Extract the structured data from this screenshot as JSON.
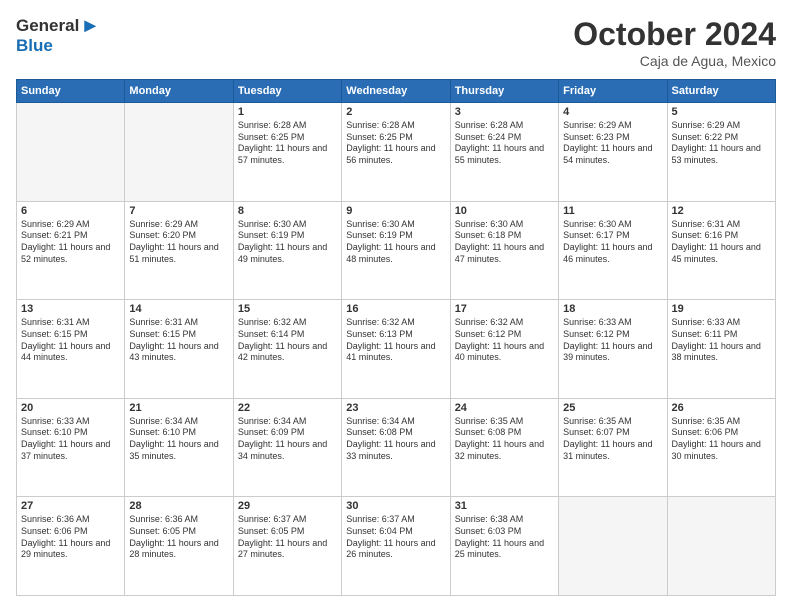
{
  "header": {
    "logo_general": "General",
    "logo_blue": "Blue",
    "month": "October 2024",
    "location": "Caja de Agua, Mexico"
  },
  "weekdays": [
    "Sunday",
    "Monday",
    "Tuesday",
    "Wednesday",
    "Thursday",
    "Friday",
    "Saturday"
  ],
  "weeks": [
    [
      {
        "day": "",
        "info": ""
      },
      {
        "day": "",
        "info": ""
      },
      {
        "day": "1",
        "info": "Sunrise: 6:28 AM\nSunset: 6:25 PM\nDaylight: 11 hours and 57 minutes."
      },
      {
        "day": "2",
        "info": "Sunrise: 6:28 AM\nSunset: 6:25 PM\nDaylight: 11 hours and 56 minutes."
      },
      {
        "day": "3",
        "info": "Sunrise: 6:28 AM\nSunset: 6:24 PM\nDaylight: 11 hours and 55 minutes."
      },
      {
        "day": "4",
        "info": "Sunrise: 6:29 AM\nSunset: 6:23 PM\nDaylight: 11 hours and 54 minutes."
      },
      {
        "day": "5",
        "info": "Sunrise: 6:29 AM\nSunset: 6:22 PM\nDaylight: 11 hours and 53 minutes."
      }
    ],
    [
      {
        "day": "6",
        "info": "Sunrise: 6:29 AM\nSunset: 6:21 PM\nDaylight: 11 hours and 52 minutes."
      },
      {
        "day": "7",
        "info": "Sunrise: 6:29 AM\nSunset: 6:20 PM\nDaylight: 11 hours and 51 minutes."
      },
      {
        "day": "8",
        "info": "Sunrise: 6:30 AM\nSunset: 6:19 PM\nDaylight: 11 hours and 49 minutes."
      },
      {
        "day": "9",
        "info": "Sunrise: 6:30 AM\nSunset: 6:19 PM\nDaylight: 11 hours and 48 minutes."
      },
      {
        "day": "10",
        "info": "Sunrise: 6:30 AM\nSunset: 6:18 PM\nDaylight: 11 hours and 47 minutes."
      },
      {
        "day": "11",
        "info": "Sunrise: 6:30 AM\nSunset: 6:17 PM\nDaylight: 11 hours and 46 minutes."
      },
      {
        "day": "12",
        "info": "Sunrise: 6:31 AM\nSunset: 6:16 PM\nDaylight: 11 hours and 45 minutes."
      }
    ],
    [
      {
        "day": "13",
        "info": "Sunrise: 6:31 AM\nSunset: 6:15 PM\nDaylight: 11 hours and 44 minutes."
      },
      {
        "day": "14",
        "info": "Sunrise: 6:31 AM\nSunset: 6:15 PM\nDaylight: 11 hours and 43 minutes."
      },
      {
        "day": "15",
        "info": "Sunrise: 6:32 AM\nSunset: 6:14 PM\nDaylight: 11 hours and 42 minutes."
      },
      {
        "day": "16",
        "info": "Sunrise: 6:32 AM\nSunset: 6:13 PM\nDaylight: 11 hours and 41 minutes."
      },
      {
        "day": "17",
        "info": "Sunrise: 6:32 AM\nSunset: 6:12 PM\nDaylight: 11 hours and 40 minutes."
      },
      {
        "day": "18",
        "info": "Sunrise: 6:33 AM\nSunset: 6:12 PM\nDaylight: 11 hours and 39 minutes."
      },
      {
        "day": "19",
        "info": "Sunrise: 6:33 AM\nSunset: 6:11 PM\nDaylight: 11 hours and 38 minutes."
      }
    ],
    [
      {
        "day": "20",
        "info": "Sunrise: 6:33 AM\nSunset: 6:10 PM\nDaylight: 11 hours and 37 minutes."
      },
      {
        "day": "21",
        "info": "Sunrise: 6:34 AM\nSunset: 6:10 PM\nDaylight: 11 hours and 35 minutes."
      },
      {
        "day": "22",
        "info": "Sunrise: 6:34 AM\nSunset: 6:09 PM\nDaylight: 11 hours and 34 minutes."
      },
      {
        "day": "23",
        "info": "Sunrise: 6:34 AM\nSunset: 6:08 PM\nDaylight: 11 hours and 33 minutes."
      },
      {
        "day": "24",
        "info": "Sunrise: 6:35 AM\nSunset: 6:08 PM\nDaylight: 11 hours and 32 minutes."
      },
      {
        "day": "25",
        "info": "Sunrise: 6:35 AM\nSunset: 6:07 PM\nDaylight: 11 hours and 31 minutes."
      },
      {
        "day": "26",
        "info": "Sunrise: 6:35 AM\nSunset: 6:06 PM\nDaylight: 11 hours and 30 minutes."
      }
    ],
    [
      {
        "day": "27",
        "info": "Sunrise: 6:36 AM\nSunset: 6:06 PM\nDaylight: 11 hours and 29 minutes."
      },
      {
        "day": "28",
        "info": "Sunrise: 6:36 AM\nSunset: 6:05 PM\nDaylight: 11 hours and 28 minutes."
      },
      {
        "day": "29",
        "info": "Sunrise: 6:37 AM\nSunset: 6:05 PM\nDaylight: 11 hours and 27 minutes."
      },
      {
        "day": "30",
        "info": "Sunrise: 6:37 AM\nSunset: 6:04 PM\nDaylight: 11 hours and 26 minutes."
      },
      {
        "day": "31",
        "info": "Sunrise: 6:38 AM\nSunset: 6:03 PM\nDaylight: 11 hours and 25 minutes."
      },
      {
        "day": "",
        "info": ""
      },
      {
        "day": "",
        "info": ""
      }
    ]
  ]
}
